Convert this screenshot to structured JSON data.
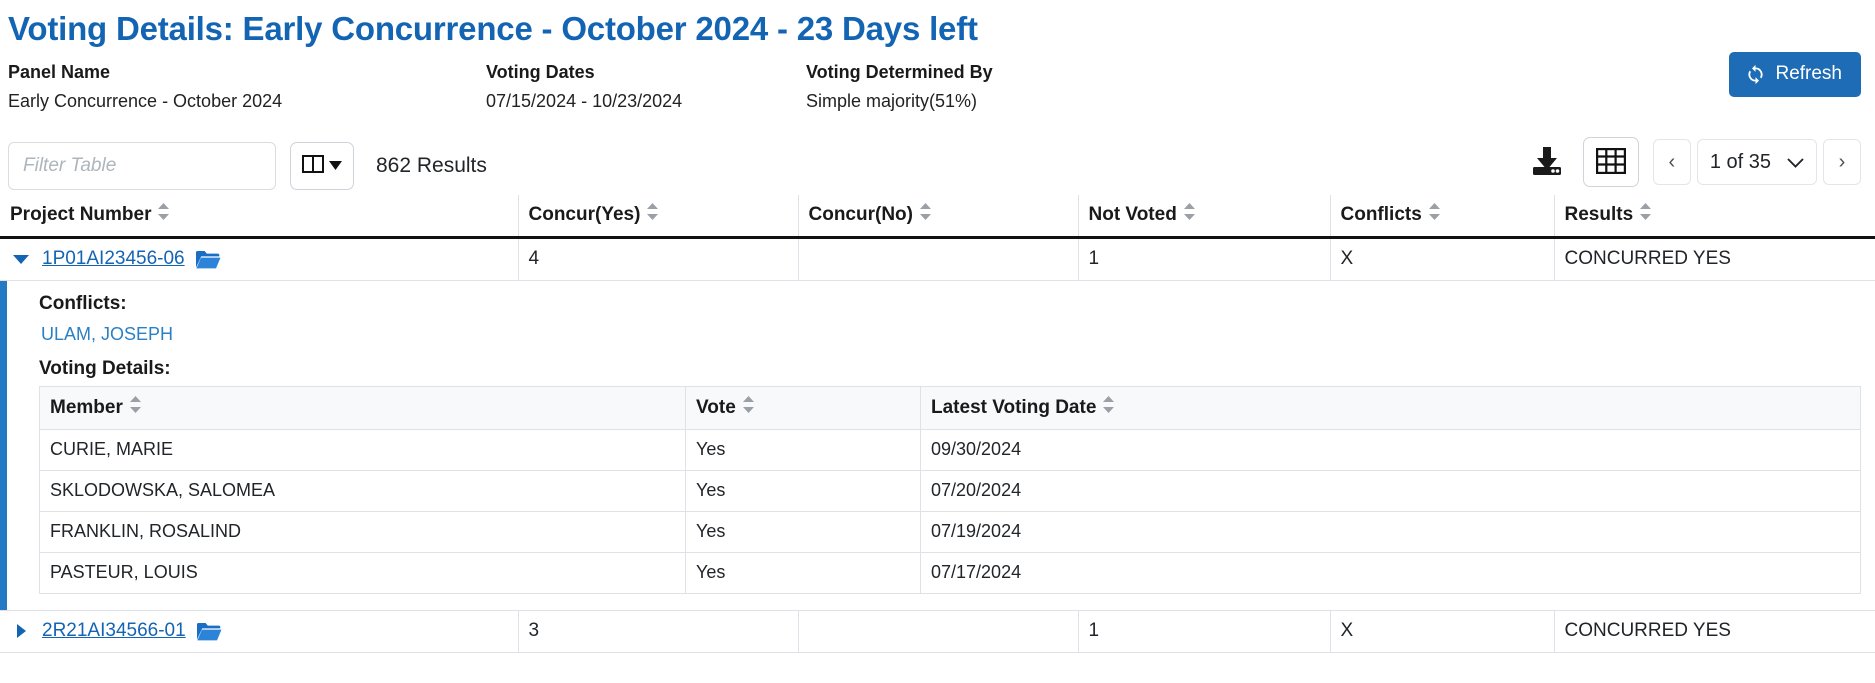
{
  "header": {
    "title": "Voting Details: Early Concurrence - October 2024 - 23 Days left",
    "fields": [
      {
        "label": "Panel Name",
        "value": "Early Concurrence - October 2024"
      },
      {
        "label": "Voting Dates",
        "value": "07/15/2024 - 10/23/2024"
      },
      {
        "label": "Voting Determined By",
        "value": "Simple majority(51%)"
      }
    ],
    "refresh_label": "Refresh",
    "accent_color": "#1e6cb5",
    "title_color": "#1464b4"
  },
  "toolbar": {
    "filter_placeholder": "Filter Table",
    "filter_value": "",
    "column_chooser_icon": "columns-icon",
    "results_text": "862 Results",
    "download_icon": "download-icon",
    "grid_view_icon": "grid-icon",
    "prev_label": "‹",
    "next_label": "›",
    "page_indicator": "1 of 35"
  },
  "table": {
    "columns": [
      "Project Number",
      "Concur(Yes)",
      "Concur(No)",
      "Not Voted",
      "Conflicts",
      "Results"
    ],
    "rows": [
      {
        "project_number": "1P01AI23456-06",
        "concur_yes": "4",
        "concur_no": "",
        "not_voted": "1",
        "conflicts": "X",
        "results": "CONCURRED YES",
        "expanded": true
      },
      {
        "project_number": "2R21AI34566-01",
        "concur_yes": "3",
        "concur_no": "",
        "not_voted": "1",
        "conflicts": "X",
        "results": "CONCURRED YES",
        "expanded": false
      }
    ]
  },
  "detail": {
    "conflicts_label": "Conflicts:",
    "conflict_names": [
      "ULAM, JOSEPH"
    ],
    "voting_details_label": "Voting Details:",
    "columns": [
      "Member",
      "Vote",
      "Latest Voting Date"
    ],
    "rows": [
      {
        "member": "CURIE, MARIE",
        "vote": "Yes",
        "date": "09/30/2024"
      },
      {
        "member": "SKLODOWSKA, SALOMEA",
        "vote": "Yes",
        "date": "07/20/2024"
      },
      {
        "member": "FRANKLIN, ROSALIND",
        "vote": "Yes",
        "date": "07/19/2024"
      },
      {
        "member": "PASTEUR, LOUIS",
        "vote": "Yes",
        "date": "07/17/2024"
      }
    ]
  }
}
